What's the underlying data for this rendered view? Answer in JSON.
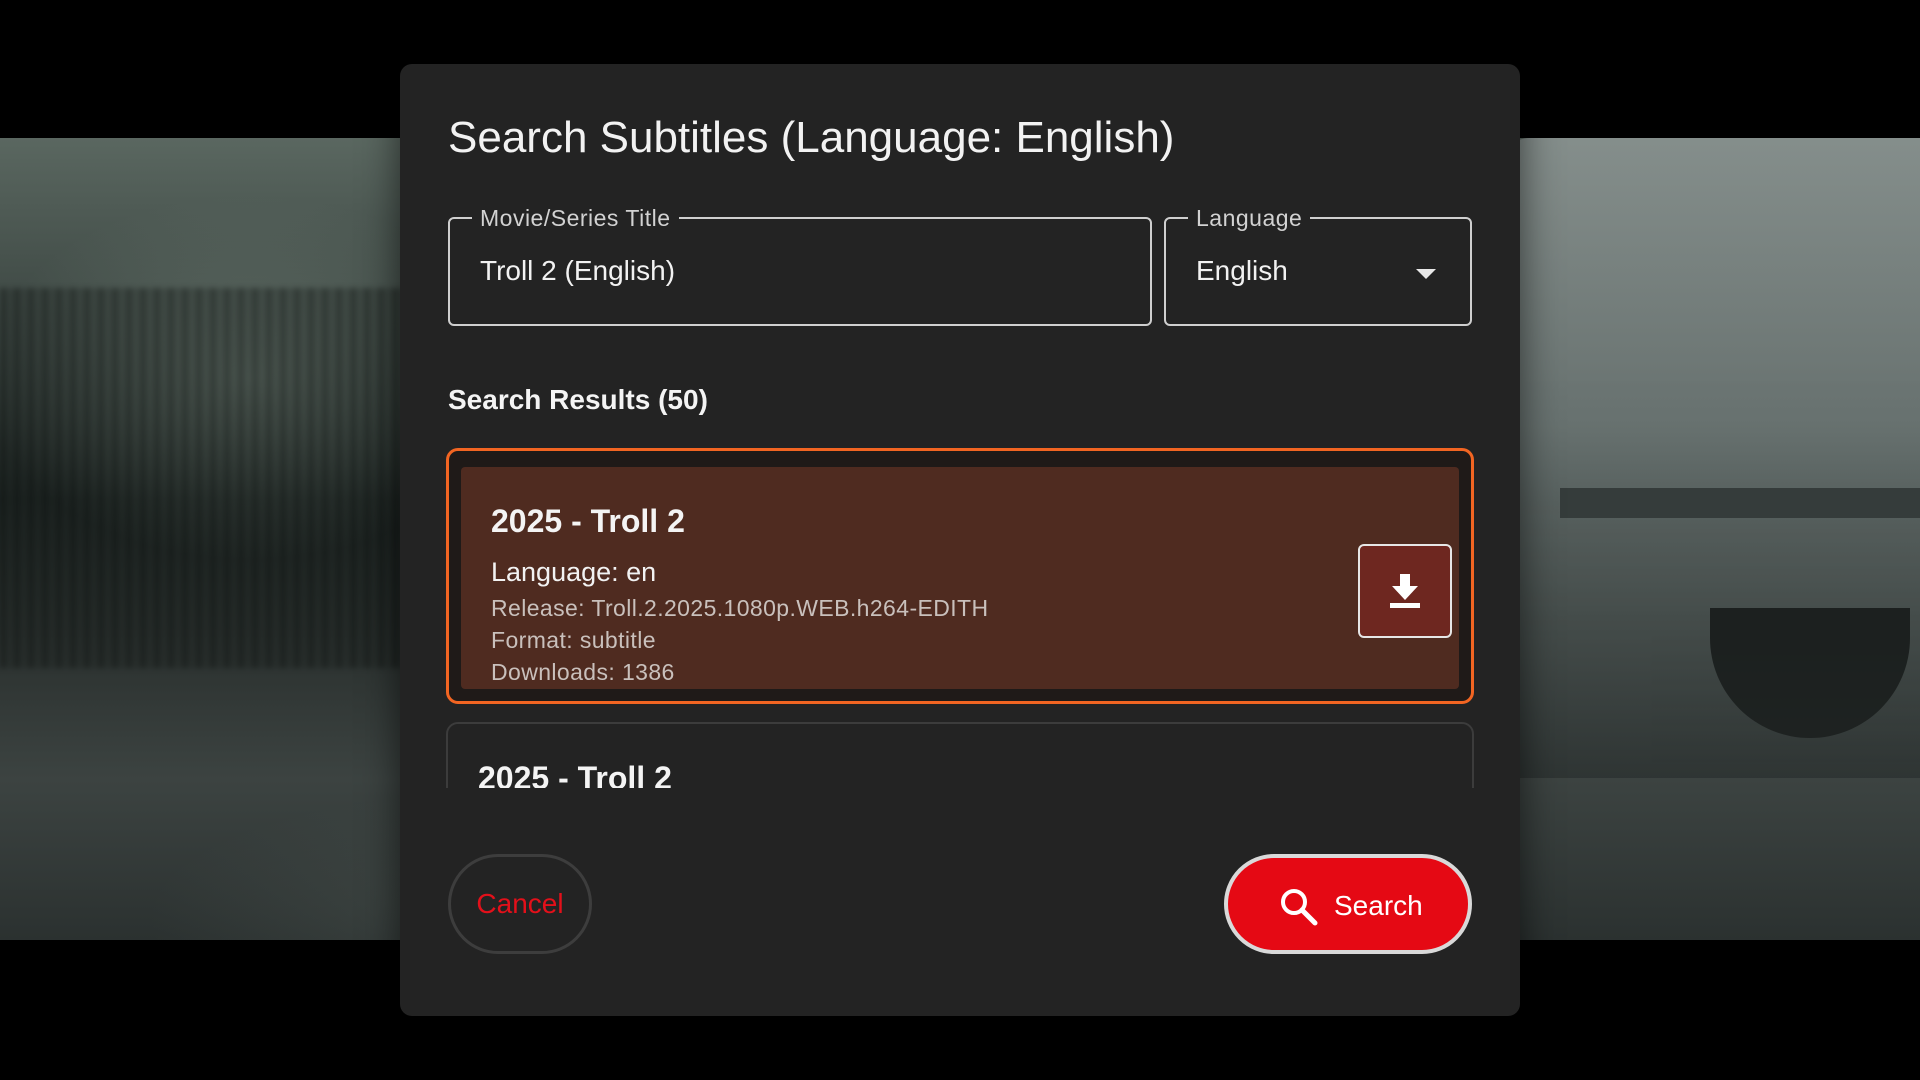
{
  "dialog": {
    "title": "Search Subtitles (Language: English)"
  },
  "form": {
    "title_field": {
      "label": "Movie/Series Title",
      "value": "Troll 2 (English)"
    },
    "language_field": {
      "label": "Language",
      "selected": "English"
    }
  },
  "results": {
    "heading": "Search Results (50)",
    "items": [
      {
        "title": "2025 - Troll 2",
        "language": "Language: en",
        "release": "Release: Troll.2.2025.1080p.WEB.h264-EDITH",
        "format": "Format: subtitle",
        "downloads": "Downloads: 1386",
        "selected": true
      },
      {
        "title": "2025 - Troll 2",
        "selected": false
      }
    ]
  },
  "actions": {
    "cancel_label": "Cancel",
    "search_label": "Search"
  },
  "icons": {
    "download": "download-icon",
    "search": "search-icon",
    "dropdown": "chevron-down-icon"
  },
  "colors": {
    "accent": "#e50914",
    "selection_border": "#f26522",
    "dialog_bg": "#232323"
  }
}
